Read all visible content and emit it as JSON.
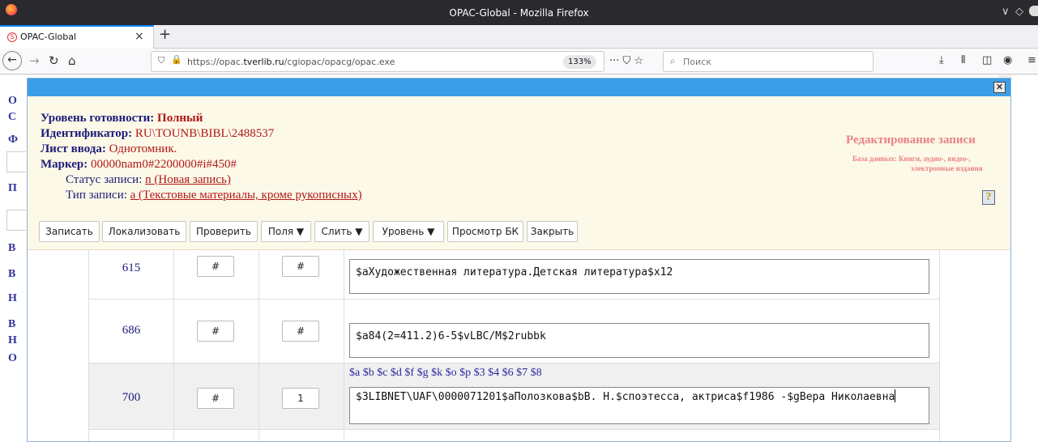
{
  "browser": {
    "window_title": "OPAC-Global - Mozilla Firefox",
    "tab_label": "OPAC-Global",
    "url_prefix": "https://opac.",
    "url_domain": "tverlib.ru",
    "url_path": "/cgiopac/opacg/opac.exe",
    "zoom": "133%",
    "search_placeholder": "Поиск"
  },
  "background_page": {
    "letters": [
      "О",
      "С",
      "Ф",
      "П",
      "В",
      "В",
      "Н",
      "В",
      "Н",
      "О"
    ]
  },
  "dialog": {
    "info": {
      "readiness_label": "Уровень готовности:",
      "readiness_value": "Полный",
      "identifier_label": "Идентификатор:",
      "identifier_value": "RU\\TOUNB\\BIBL\\2488537",
      "sheet_label": "Лист ввода:",
      "sheet_value": "Однотомник.",
      "marker_label": "Маркер:",
      "marker_value": "00000nam0#2200000#i#450#",
      "status_label": "Статус записи:",
      "status_value": "n (Новая запись)",
      "type_label": "Тип записи:",
      "type_value": "a (Текстовые материалы, кроме рукописных)"
    },
    "edit_title": "Редактирование записи",
    "database_line1": "База данных: Книги, аудио-, видео-,",
    "database_line2": "электронные издания",
    "toolbar": {
      "write": "Записать",
      "localize": "Локализовать",
      "check": "Проверить",
      "fields": "Поля ▼",
      "merge": "Слить ▼",
      "level": "Уровень ▼",
      "view_bk": "Просмотр БК",
      "close": "Закрыть"
    },
    "rows": [
      {
        "tag": "615",
        "ind1": "#",
        "ind2": "#",
        "value": "$aХудожественная литература.Детская литература$x12"
      },
      {
        "tag": "686",
        "ind1": "#",
        "ind2": "#",
        "value": "$a84(2=411.2)6-5$vLBC/M$2rubbk"
      },
      {
        "tag": "700",
        "ind1": "#",
        "ind2": "1",
        "subfields": "$a $b $c $d $f $g $k $o $p $3 $4 $6 $7 $8",
        "value": "$3LIBNET\\UAF\\0000071201$aПолозкова$bВ. Н.$cпоэтесса, актриса$f1986 -$gВера Николаевна"
      }
    ]
  },
  "colors": {
    "dialog_header": "#3b9ee8",
    "info_background": "#fdf9e8",
    "label_blue": "#1c1c7a",
    "value_red": "#b01818",
    "edit_title_pink": "#e88383"
  }
}
